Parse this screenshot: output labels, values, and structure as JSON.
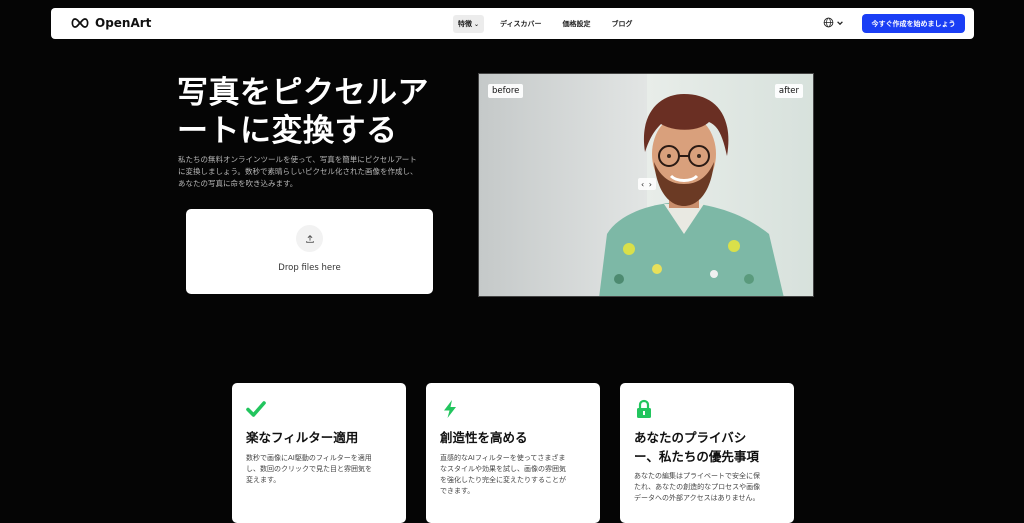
{
  "header": {
    "logo_text": "OpenArt",
    "nav": [
      {
        "label": "特徴",
        "has_dropdown": true
      },
      {
        "label": "ディスカバー"
      },
      {
        "label": "価格設定"
      },
      {
        "label": "ブログ"
      }
    ],
    "language_icon": "globe-icon",
    "cta_label": "今すぐ作成を始めましょう"
  },
  "hero": {
    "title_line1": "写真をピクセルア",
    "title_line2": "ートに変換する",
    "description_line1": "私たちの無料オンラインツールを使って、写真を簡単にピクセルアート",
    "description_line2": "に変換しましょう。数秒で素晴らしいピクセル化された画像を作成し、",
    "description_line3": "あなたの写真に命を吹き込みます。",
    "drop_label": "Drop files here"
  },
  "compare": {
    "before_label": "before",
    "after_label": "after",
    "handle_label": "‹ ›"
  },
  "features": [
    {
      "icon": "check-icon",
      "title": "楽なフィルター適用",
      "desc_lines": [
        "数秒で画像にAI駆動のフィルターを適用",
        "し、数回のクリックで見た目と雰囲気を",
        "変えます。"
      ]
    },
    {
      "icon": "lightning-icon",
      "title": "創造性を高める",
      "desc_lines": [
        "直感的なAIフィルターを使ってさまざま",
        "なスタイルや効果を試し、画像の雰囲気",
        "を強化したり完全に変えたりすることが",
        "できます。"
      ]
    },
    {
      "icon": "lock-icon",
      "title_lines": [
        "あなたのプライバシ",
        "ー、私たちの優先事項"
      ],
      "desc_lines": [
        "あなたの編集はプライベートで安全に保",
        "たれ、あなたの創造的なプロセスや画像",
        "データへの外部アクセスはありません。"
      ]
    }
  ],
  "colors": {
    "background": "#050505",
    "accent": "#1a3ef5",
    "feature_icon": "#22c55e"
  }
}
